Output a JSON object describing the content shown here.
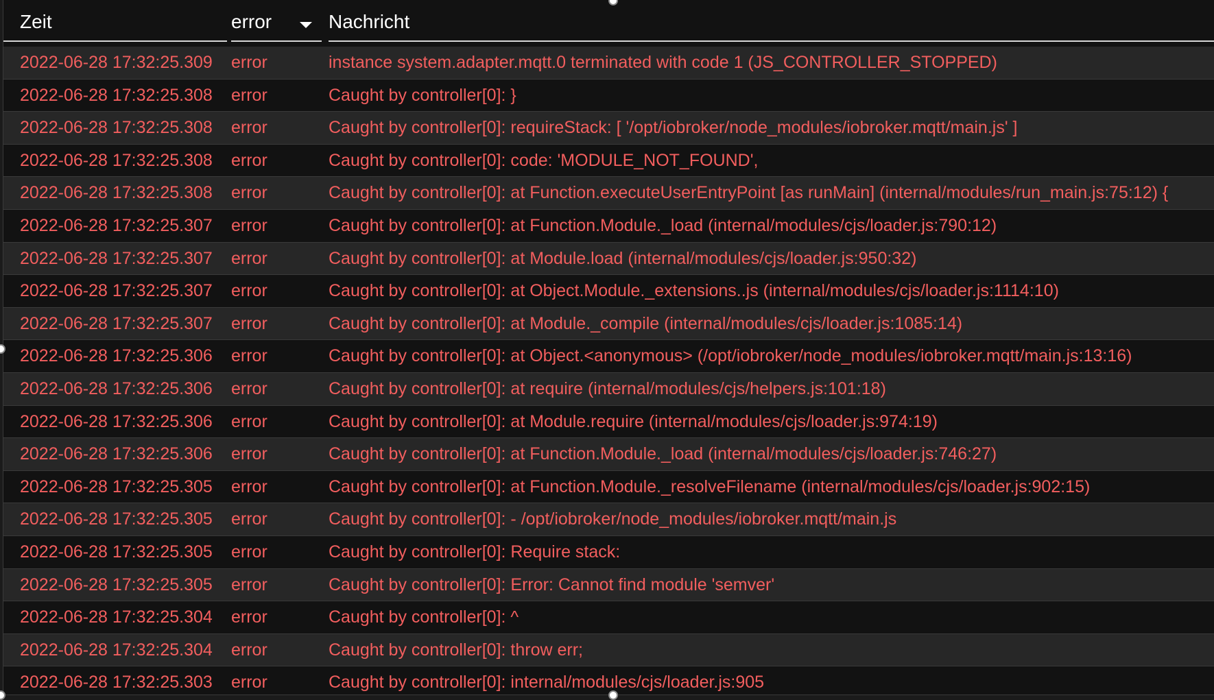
{
  "header": {
    "time_label": "Zeit",
    "severity_filter": "error",
    "message_label": "Nachricht"
  },
  "colors": {
    "error_text": "#f25e5e",
    "row_odd": "#272727",
    "row_even": "#121212"
  },
  "rows": [
    {
      "time": "2022-06-28 17:32:25.309",
      "severity": "error",
      "message": "instance system.adapter.mqtt.0 terminated with code 1 (JS_CONTROLLER_STOPPED)"
    },
    {
      "time": "2022-06-28 17:32:25.308",
      "severity": "error",
      "message": "Caught by controller[0]: }"
    },
    {
      "time": "2022-06-28 17:32:25.308",
      "severity": "error",
      "message": "Caught by controller[0]: requireStack: [ '/opt/iobroker/node_modules/iobroker.mqtt/main.js' ]"
    },
    {
      "time": "2022-06-28 17:32:25.308",
      "severity": "error",
      "message": "Caught by controller[0]: code: 'MODULE_NOT_FOUND',"
    },
    {
      "time": "2022-06-28 17:32:25.308",
      "severity": "error",
      "message": "Caught by controller[0]: at Function.executeUserEntryPoint [as runMain] (internal/modules/run_main.js:75:12) {"
    },
    {
      "time": "2022-06-28 17:32:25.307",
      "severity": "error",
      "message": "Caught by controller[0]: at Function.Module._load (internal/modules/cjs/loader.js:790:12)"
    },
    {
      "time": "2022-06-28 17:32:25.307",
      "severity": "error",
      "message": "Caught by controller[0]: at Module.load (internal/modules/cjs/loader.js:950:32)"
    },
    {
      "time": "2022-06-28 17:32:25.307",
      "severity": "error",
      "message": "Caught by controller[0]: at Object.Module._extensions..js (internal/modules/cjs/loader.js:1114:10)"
    },
    {
      "time": "2022-06-28 17:32:25.307",
      "severity": "error",
      "message": "Caught by controller[0]: at Module._compile (internal/modules/cjs/loader.js:1085:14)"
    },
    {
      "time": "2022-06-28 17:32:25.306",
      "severity": "error",
      "message": "Caught by controller[0]: at Object.<anonymous> (/opt/iobroker/node_modules/iobroker.mqtt/main.js:13:16)"
    },
    {
      "time": "2022-06-28 17:32:25.306",
      "severity": "error",
      "message": "Caught by controller[0]: at require (internal/modules/cjs/helpers.js:101:18)"
    },
    {
      "time": "2022-06-28 17:32:25.306",
      "severity": "error",
      "message": "Caught by controller[0]: at Module.require (internal/modules/cjs/loader.js:974:19)"
    },
    {
      "time": "2022-06-28 17:32:25.306",
      "severity": "error",
      "message": "Caught by controller[0]: at Function.Module._load (internal/modules/cjs/loader.js:746:27)"
    },
    {
      "time": "2022-06-28 17:32:25.305",
      "severity": "error",
      "message": "Caught by controller[0]: at Function.Module._resolveFilename (internal/modules/cjs/loader.js:902:15)"
    },
    {
      "time": "2022-06-28 17:32:25.305",
      "severity": "error",
      "message": "Caught by controller[0]: - /opt/iobroker/node_modules/iobroker.mqtt/main.js"
    },
    {
      "time": "2022-06-28 17:32:25.305",
      "severity": "error",
      "message": "Caught by controller[0]: Require stack:"
    },
    {
      "time": "2022-06-28 17:32:25.305",
      "severity": "error",
      "message": "Caught by controller[0]: Error: Cannot find module 'semver'"
    },
    {
      "time": "2022-06-28 17:32:25.304",
      "severity": "error",
      "message": "Caught by controller[0]: ^"
    },
    {
      "time": "2022-06-28 17:32:25.304",
      "severity": "error",
      "message": "Caught by controller[0]: throw err;"
    },
    {
      "time": "2022-06-28 17:32:25.303",
      "severity": "error",
      "message": "Caught by controller[0]: internal/modules/cjs/loader.js:905"
    }
  ]
}
